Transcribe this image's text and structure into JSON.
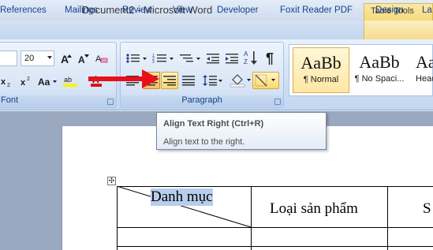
{
  "window": {
    "title": "Document2 - Microsoft Word",
    "context_tab_group": "Table Tools"
  },
  "tabs": [
    "References",
    "Mailings",
    "Review",
    "View",
    "Developer",
    "Foxit Reader PDF",
    "Design",
    "La"
  ],
  "font_group": {
    "label": "Font",
    "font_size": "20"
  },
  "paragraph_group": {
    "label": "Paragraph"
  },
  "styles": [
    {
      "sample": "AaBb",
      "name": "¶ Normal",
      "selected": true
    },
    {
      "sample": "AaBb",
      "name": "¶ No Spaci...",
      "selected": false
    },
    {
      "sample": "AaB",
      "name": "Head",
      "selected": false
    }
  ],
  "tooltip": {
    "title": "Align Text Right (Ctrl+R)",
    "description": "Align text to the right."
  },
  "table": {
    "cell1": "Danh mục",
    "cell2": "Loại sản phẩm",
    "cell3": "S"
  },
  "colors": {
    "arrow": "#e8101a",
    "highlight": "#ffd86a",
    "selection": "#b7cdeb"
  },
  "icons": {
    "font_buttons": [
      "grow-font-icon",
      "shrink-font-icon",
      "clear-formatting-icon",
      "subscript-icon",
      "superscript-icon",
      "change-case-icon",
      "highlight-icon",
      "font-color-icon"
    ],
    "paragraph_buttons": [
      "bullets-icon",
      "numbering-icon",
      "multilevel-list-icon",
      "decrease-indent-icon",
      "increase-indent-icon",
      "sort-icon",
      "show-marks-icon",
      "align-center-icon",
      "align-right-icon",
      "justify-icon",
      "line-spacing-icon",
      "shading-icon",
      "borders-icon"
    ]
  }
}
